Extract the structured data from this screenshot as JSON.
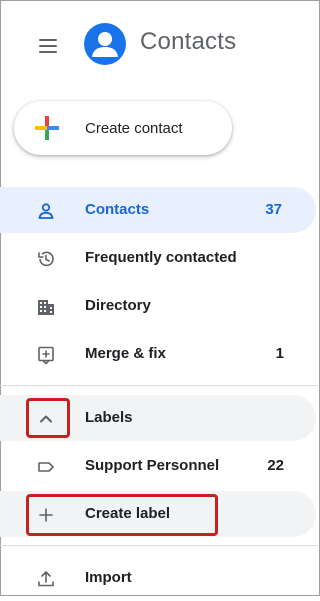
{
  "app": {
    "title": "Contacts"
  },
  "create_button": {
    "label": "Create contact"
  },
  "nav": {
    "contacts": {
      "label": "Contacts",
      "count": "37"
    },
    "frequent": {
      "label": "Frequently contacted"
    },
    "directory": {
      "label": "Directory"
    },
    "merge": {
      "label": "Merge & fix",
      "count": "1"
    }
  },
  "labels_section": {
    "header": "Labels",
    "items": [
      {
        "label": "Support Personnel",
        "count": "22"
      }
    ],
    "create_label": "Create label"
  },
  "import": {
    "label": "Import"
  },
  "icons": {
    "menu": "hamburger-icon",
    "logo": "contacts-logo-icon",
    "plus": "colorful-plus-icon",
    "contacts": "person-icon",
    "frequent": "history-icon",
    "directory": "building-icon",
    "merge": "merge-fix-icon",
    "collapse": "chevron-up-icon",
    "label": "label-tag-icon",
    "add": "plus-icon",
    "import": "import-upload-icon"
  },
  "colors": {
    "brand_blue": "#1a73e8",
    "active_bg": "#e8f0fe",
    "active_text": "#1967d2",
    "highlight_red": "#c5221f"
  }
}
